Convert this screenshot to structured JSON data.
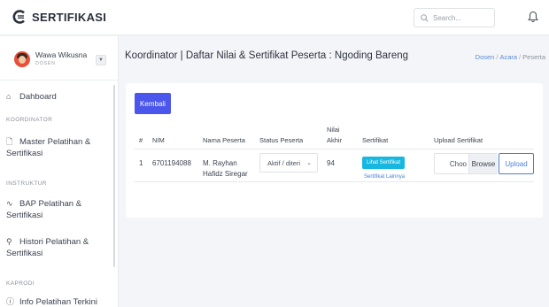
{
  "app": {
    "title": "SERTIFIKASI",
    "logo_icon": "certificate-c-icon",
    "brand_color": "#2a2f3a",
    "accent_color": "#4b56ec"
  },
  "search": {
    "placeholder": "Search...",
    "icon": "search-icon"
  },
  "header": {
    "notification_icon": "bell-icon"
  },
  "user": {
    "name": "Wawa Wikusna",
    "role": "DOSEN",
    "toggle_icon": "chevron-down-icon"
  },
  "sidebar": {
    "dashboard": {
      "label": "Dahboard",
      "icon": "home-icon"
    },
    "sections": [
      {
        "label": "KOORDINATOR",
        "items": [
          {
            "label": "Master Pelatihan & Sertifikasi",
            "icon": "clipboard-icon"
          }
        ]
      },
      {
        "label": "INSTRUKTUR",
        "items": [
          {
            "label": "BAP Pelatihan & Sertifikasi",
            "icon": "activity-icon"
          }
        ]
      },
      {
        "label": "",
        "items": [
          {
            "label": "Histori Pelatihan & Sertifikasi",
            "icon": "user-badge-icon"
          }
        ]
      },
      {
        "label": "KAPRODI",
        "items": [
          {
            "label": "Info Pelatihan Terkini",
            "icon": "info-icon"
          }
        ]
      }
    ]
  },
  "page": {
    "title": "Koordinator | Daftar Nilai & Sertifikat Peserta : Ngoding Bareng",
    "breadcrumb": [
      "Dosen",
      "Acara",
      "Peserta"
    ],
    "back_button": "Kembali"
  },
  "table": {
    "headers": {
      "no": "#",
      "nim": "NIM",
      "name": "Nama Peserta",
      "status": "Status Peserta",
      "grade_line1": "Nilai",
      "grade_line2": "Akhir",
      "certificate": "Sertifikat",
      "upload": "Upload Sertifikat"
    },
    "rows": [
      {
        "no": "1",
        "nim": "6701194088",
        "name_line1": "M. Rayhan",
        "name_line2": "Hafidz Siregar",
        "status": "Aktif / diteri",
        "grade": "94",
        "view_certificate": "Lihat Sertifikat",
        "other_certificate": "Sertifikat Lainnya",
        "file_choose": "Choo",
        "file_browse": "Browse",
        "upload": "Upload"
      }
    ]
  }
}
